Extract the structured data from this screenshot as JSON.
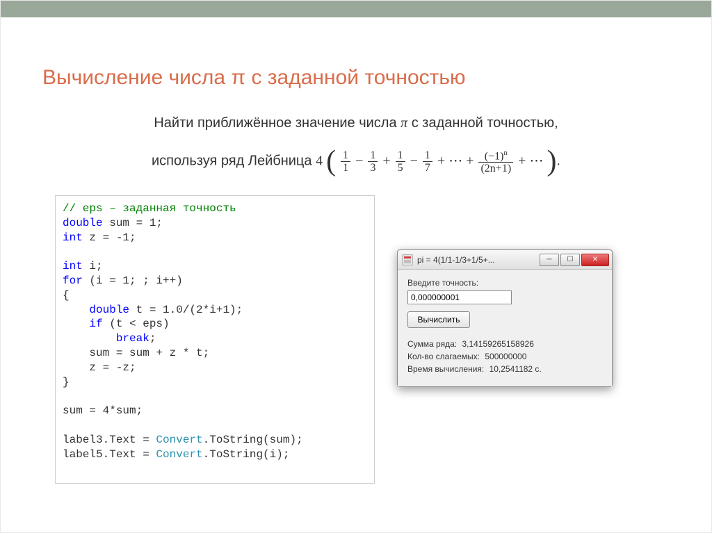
{
  "slide": {
    "title": "Вычисление числа π с заданной точностью",
    "subtitle_pre": "Найти приближённое значение числа ",
    "subtitle_pi": "π",
    "subtitle_post": " с заданной точностью,",
    "subtitle_line2_pre": "используя ряд Лейбница ",
    "formula_leading": "4",
    "frac1_num": "1",
    "frac1_den": "1",
    "frac2_num": "1",
    "frac2_den": "3",
    "frac3_num": "1",
    "frac3_den": "5",
    "frac4_num": "1",
    "frac4_den": "7",
    "dots": "⋯",
    "fracn_num": "(−1)",
    "fracn_num_sup": "n",
    "fracn_den": "(2n+1)",
    "formula_tail": "."
  },
  "code": {
    "l1": "// eps – заданная точность",
    "l2a": "double",
    "l2b": " sum = 1;",
    "l3a": "int",
    "l3b": " z = -1;",
    "l4": "",
    "l5a": "int",
    "l5b": " i;",
    "l6a": "for",
    "l6b": " (i = 1; ; i++)",
    "l7": "{",
    "l8a": "    double",
    "l8b": " t = 1.0/(2*i+1);",
    "l9a": "    if",
    "l9b": " (t < eps)",
    "l10a": "        break",
    "l10b": ";",
    "l11": "    sum = sum + z * t;",
    "l12": "    z = -z;",
    "l13": "}",
    "l14": "",
    "l15": "sum = 4*sum;",
    "l16": "",
    "l17a": "label3.Text = ",
    "l17b": "Convert",
    "l17c": ".ToString(sum);",
    "l18a": "label5.Text = ",
    "l18b": "Convert",
    "l18c": ".ToString(i);"
  },
  "window": {
    "title": "pi = 4(1/1-1/3+1/5+...",
    "precision_label": "Введите точность:",
    "precision_value": "0,000000001",
    "calc_button": "Вычислить",
    "result_sum_label": "Сумма ряда:",
    "result_sum_value": "3,14159265158926",
    "result_count_label": "Кол-во слагаемых:",
    "result_count_value": "500000000",
    "result_time_label": "Время вычисления:",
    "result_time_value": "10,2541182 с."
  }
}
